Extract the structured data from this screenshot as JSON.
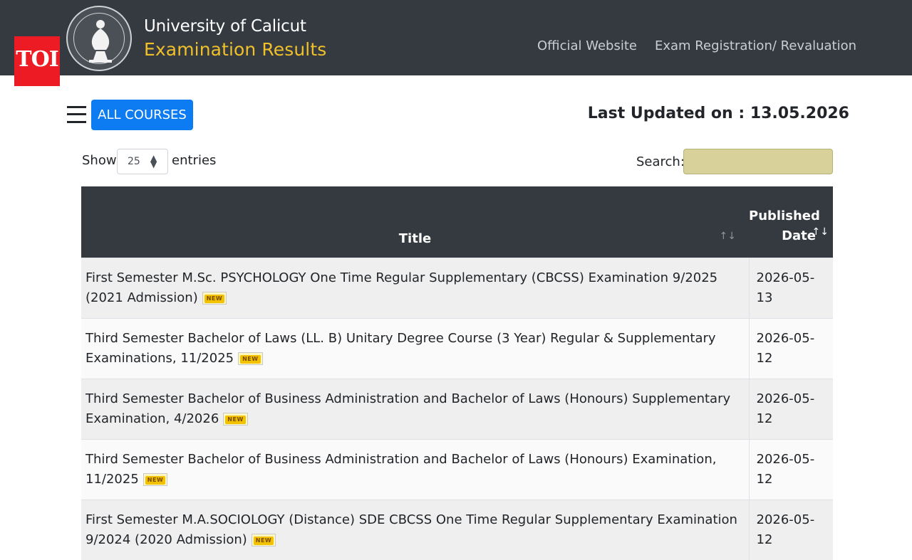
{
  "header": {
    "brand_line1": "University of Calicut",
    "brand_line2": "Examination Results",
    "nav": [
      "Official Website",
      "Exam Registration/ Revaluation"
    ],
    "logo_icon": "university-seal-icon",
    "colors": {
      "navbar": "#343a40",
      "brand_accent": "#f0c02b"
    }
  },
  "watermark": {
    "text": "TOI",
    "color": "#ed1c24"
  },
  "toolbar": {
    "menu_icon": "hamburger-menu-icon",
    "all_courses_label": "ALL COURSES",
    "last_updated": "Last Updated on : 13.05.2026",
    "button_color": "#0d7cf2"
  },
  "controls": {
    "show_label": "Show",
    "page_size": "25",
    "entries_label": "entries",
    "search_label": "Search:",
    "search_value": ""
  },
  "table": {
    "headers": {
      "title": "Title",
      "date_line1": "Published",
      "date_line2": "Date"
    },
    "new_badge": "NEW",
    "rows": [
      {
        "title": "First Semester M.Sc. PSYCHOLOGY One Time Regular Supplementary (CBCSS) Examination 9/2025 (2021 Admission)",
        "date": "2026-05-13"
      },
      {
        "title": "Third Semester Bachelor of Laws (LL. B) Unitary Degree Course (3 Year) Regular & Supplementary Examinations, 11/2025",
        "date": "2026-05-12"
      },
      {
        "title": "Third Semester Bachelor of Business Administration and Bachelor of Laws (Honours) Supplementary Examination, 4/2026",
        "date": "2026-05-12"
      },
      {
        "title": "Third Semester Bachelor of Business Administration and Bachelor of Laws (Honours) Examination, 11/2025",
        "date": "2026-05-12"
      },
      {
        "title": "First Semester M.A.SOCIOLOGY (Distance) SDE CBCSS One Time Regular Supplementary Examination 9/2024 (2020 Admission)",
        "date": "2026-05-12"
      }
    ]
  }
}
